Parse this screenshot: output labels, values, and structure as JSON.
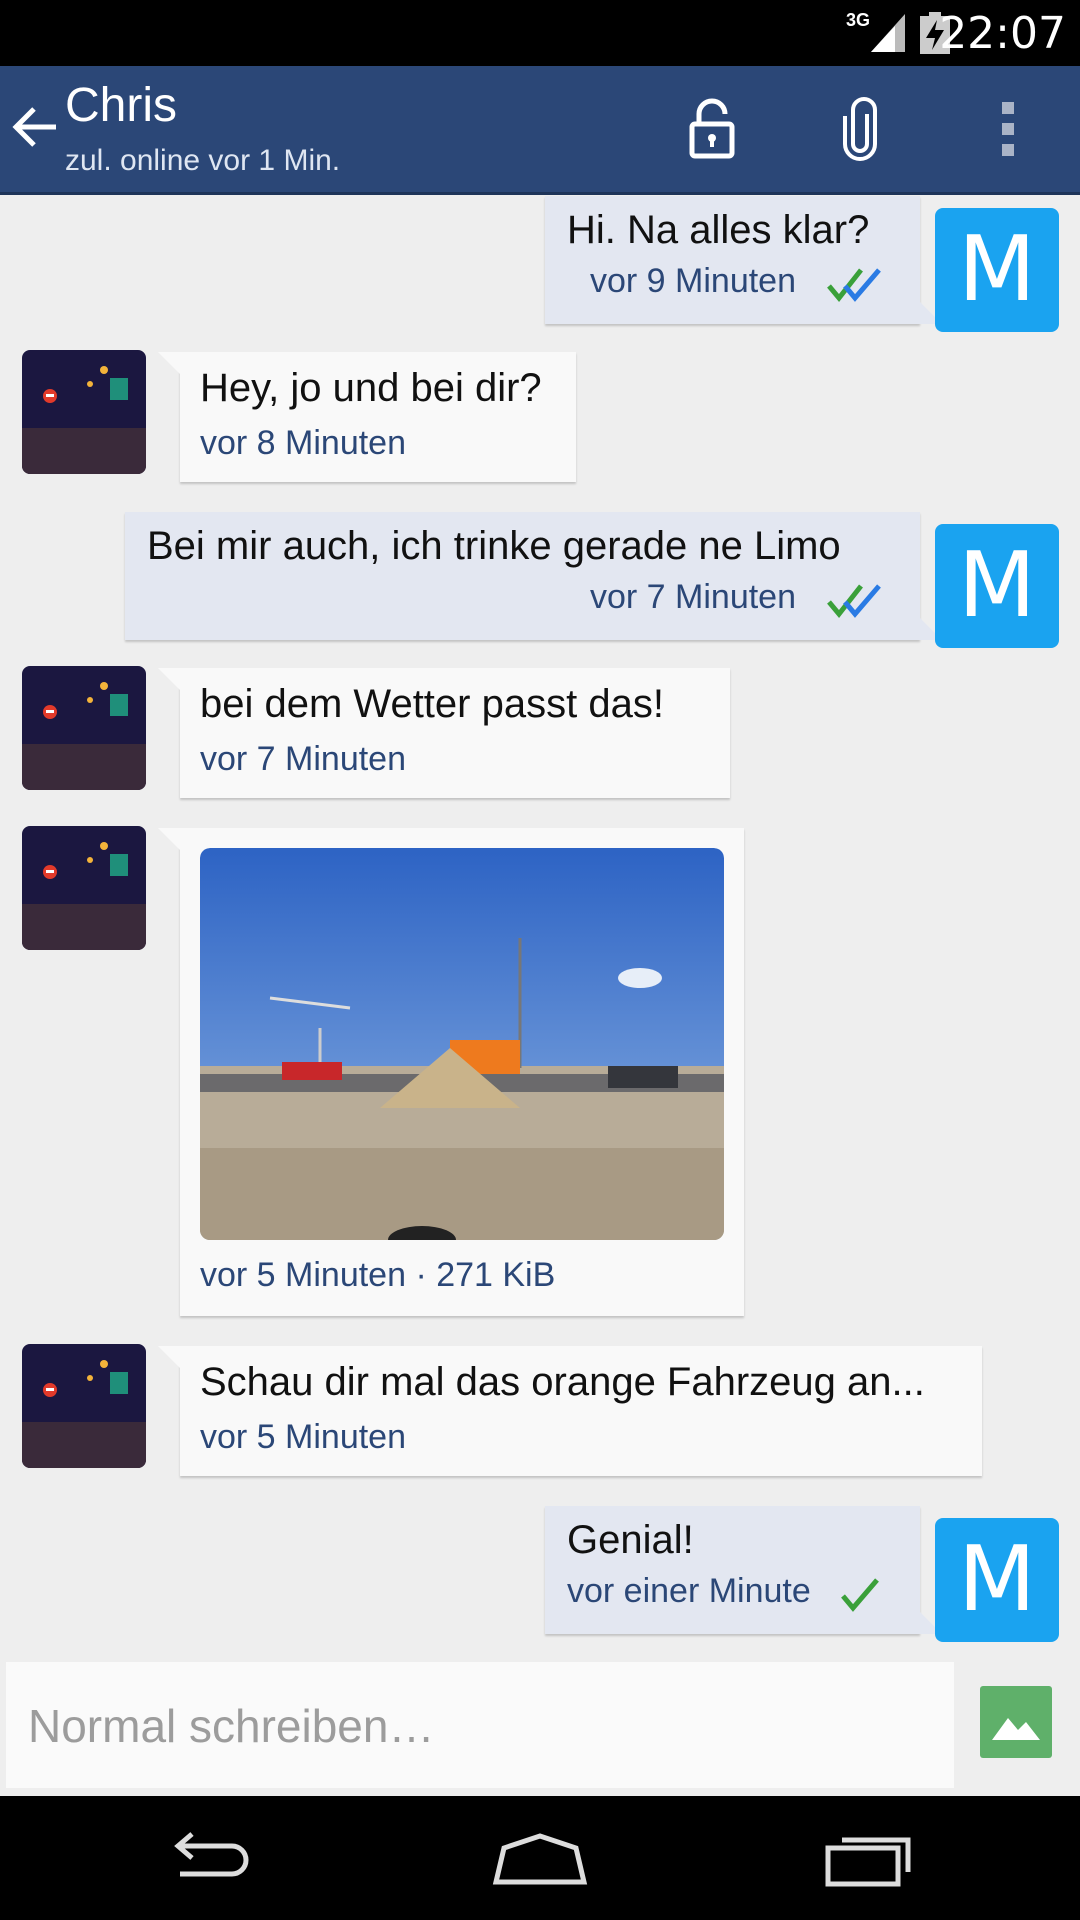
{
  "status_bar": {
    "network": "3G",
    "time": "22:07"
  },
  "app_bar": {
    "contact_name": "Chris",
    "last_seen": "zul. online vor 1 Min.",
    "icons": [
      "back-arrow-icon",
      "lock-open-icon",
      "attach-paperclip-icon",
      "overflow-menu-icon"
    ]
  },
  "messages": [
    {
      "direction": "out",
      "text": "Hi. Na alles klar?",
      "time": "vor 9 Minuten",
      "status": "read",
      "avatar_letter": "M"
    },
    {
      "direction": "in",
      "text": "Hey, jo und bei dir?",
      "time": "vor 8 Minuten"
    },
    {
      "direction": "out",
      "text": "Bei mir auch, ich trinke gerade ne Limo",
      "time": "vor 7 Minuten",
      "status": "read",
      "avatar_letter": "M"
    },
    {
      "direction": "in",
      "text": " bei dem Wetter passt das!",
      "time": "vor 7 Minuten"
    },
    {
      "direction": "in",
      "type": "image",
      "caption": "vor 5 Minuten · 271 KiB"
    },
    {
      "direction": "in",
      "text": "Schau dir mal das orange Fahrzeug an...",
      "time": "vor 5 Minuten"
    },
    {
      "direction": "out",
      "text": "Genial!",
      "time": "vor einer Minute",
      "status": "sent",
      "avatar_letter": "M"
    }
  ],
  "composer": {
    "placeholder": "Normal schreiben…"
  },
  "colors": {
    "app_bar": "#2b4777",
    "avatar_m": "#1aa3f0",
    "read_check_blue": "#2a7be4",
    "check_green": "#3aa03a",
    "gallery_button": "#5fb06a"
  }
}
